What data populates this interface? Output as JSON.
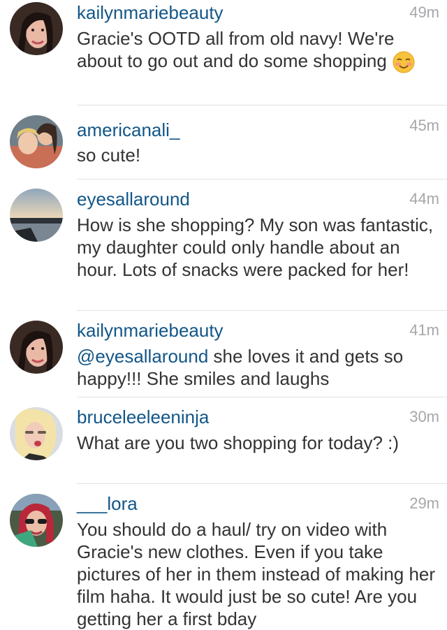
{
  "comments": [
    {
      "username": "kailynmariebeauty",
      "time": "49m",
      "text": "Gracie's OOTD all from old navy! We're about to go out and do some shopping",
      "emoji": "smiling-blush-emoji"
    },
    {
      "username": "americanali_",
      "time": "45m",
      "text": "so cute!"
    },
    {
      "username": "eyesallaround",
      "time": "44m",
      "text": "How is she shopping? My son was fantastic, my daughter could only handle about an hour. Lots of snacks were packed for her!"
    },
    {
      "username": "kailynmariebeauty",
      "time": "41m",
      "mention": "@eyesallaround",
      "text": " she loves it and gets so happy!!! She smiles and laughs"
    },
    {
      "username": "bruceleeleeninja",
      "time": "30m",
      "text": "What are you two shopping for today? :)"
    },
    {
      "username": "___lora",
      "time": "29m",
      "text": "You should do a haul/ try on video with Gracie's new clothes. Even if you take pictures of her in them instead of making her film haha. It would just be so cute! Are you getting her a first bday"
    }
  ]
}
